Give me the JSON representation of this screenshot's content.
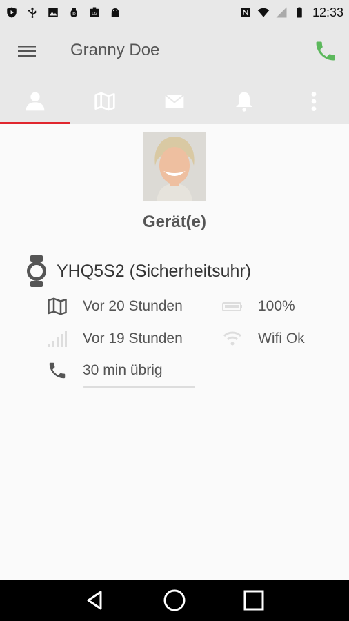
{
  "status_bar": {
    "time": "12:33",
    "icons_left": [
      "play-shield-icon",
      "usb-icon",
      "image-icon",
      "bug-icon",
      "lg-icon",
      "android-icon"
    ],
    "icons_right": [
      "nfc-icon",
      "wifi-icon",
      "signal-icon",
      "battery-icon"
    ]
  },
  "app_bar": {
    "title": "Granny Doe",
    "call_color": "#4caf50"
  },
  "tabs": [
    {
      "name": "person-icon",
      "active": true
    },
    {
      "name": "map-icon",
      "active": false
    },
    {
      "name": "mail-icon",
      "active": false
    },
    {
      "name": "bell-icon",
      "active": false
    },
    {
      "name": "more-vert-icon",
      "active": false
    }
  ],
  "accent_color": "#e0262e",
  "content": {
    "section_title": "Gerät(e)",
    "device": {
      "name": "YHQ5S2 (Sicherheitsuhr)",
      "location_time": "Vor 20 Stunden",
      "battery": "100%",
      "signal_time": "Vor 19 Stunden",
      "wifi": "Wifi Ok",
      "call_remaining": "30 min übrig"
    }
  },
  "navbar": [
    "back-icon",
    "home-icon",
    "recents-icon"
  ]
}
